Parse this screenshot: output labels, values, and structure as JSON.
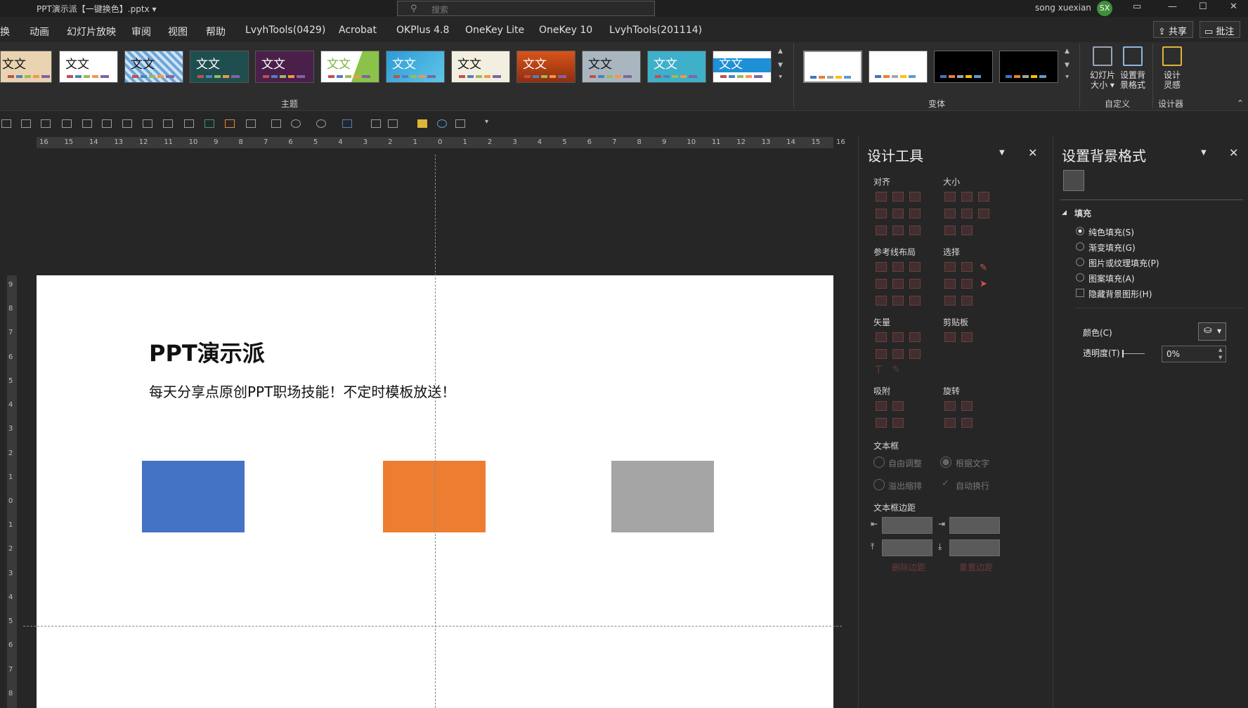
{
  "window": {
    "title": "PPT演示派【一键换色】.pptx",
    "title_caret": "▾",
    "search_placeholder": "搜索",
    "user_name": "song xuexian",
    "user_initials": "SX"
  },
  "menu": {
    "items": [
      "换",
      "动画",
      "幻灯片放映",
      "审阅",
      "视图",
      "帮助",
      "LvyhTools(0429)",
      "Acrobat",
      "OKPlus 4.8",
      "OneKey Lite",
      "OneKey 10",
      "LvyhTools(201114)"
    ],
    "share_label": "共享",
    "comment_label": "批注"
  },
  "ribbon": {
    "theme_group_label": "主题",
    "variant_group_label": "变体",
    "customize_group_label": "自定义",
    "designer_group_label": "设计器",
    "theme_thumb_text": [
      "文文",
      "文文",
      "文文",
      "文文",
      "文文",
      "文文",
      "文文",
      "文文",
      "文文",
      "文文",
      "文文",
      "文文"
    ],
    "slide_size_label_1": "幻灯片",
    "slide_size_label_2": "大小 ▾",
    "format_bg_label_1": "设置背",
    "format_bg_label_2": "景格式",
    "design_ideas_label_1": "设计",
    "design_ideas_label_2": "灵感"
  },
  "rulers": {
    "horizontal": [
      "16",
      "15",
      "14",
      "13",
      "12",
      "11",
      "10",
      "9",
      "8",
      "7",
      "6",
      "5",
      "4",
      "3",
      "2",
      "1",
      "0",
      "1",
      "2",
      "3",
      "4",
      "5",
      "6",
      "7",
      "8",
      "9",
      "10",
      "11",
      "12",
      "13",
      "14",
      "15",
      "16"
    ],
    "vertical": [
      "9",
      "8",
      "7",
      "6",
      "5",
      "4",
      "3",
      "2",
      "1",
      "0",
      "1",
      "2",
      "3",
      "4",
      "5",
      "6",
      "7",
      "8"
    ]
  },
  "slide": {
    "title": "PPT演示派",
    "subtitle": "每天分享点原创PPT职场技能！不定时模板放送！",
    "rect_colors": [
      "#4472c4",
      "#ed7d31",
      "#a5a5a5"
    ]
  },
  "design_tools": {
    "title": "设计工具",
    "sections": {
      "align": "对齐",
      "size": "大小",
      "guides": "参考线布局",
      "select": "选择",
      "vector": "矢量",
      "clipboard": "剪贴板",
      "snap": "吸附",
      "rotate": "旋转",
      "textbox": "文本框",
      "margins": "文本框边距"
    },
    "autofit": "自由调整",
    "fit_text": "根据文字",
    "overflow": "溢出缩排",
    "wrap": "自动换行",
    "delete_margin": "删除边距",
    "reset_margin": "重置边距"
  },
  "format_background": {
    "title": "设置背景格式",
    "fill_header": "填充",
    "options": [
      "纯色填充(S)",
      "渐变填充(G)",
      "图片或纹理填充(P)",
      "图案填充(A)"
    ],
    "hide_bg": "隐藏背景图形(H)",
    "color_label": "颜色(C)",
    "transparency_label": "透明度(T)",
    "transparency_value": "0%"
  },
  "colors": {
    "accent_red": "#c0504d",
    "avatar_green": "#3f8f3b"
  }
}
